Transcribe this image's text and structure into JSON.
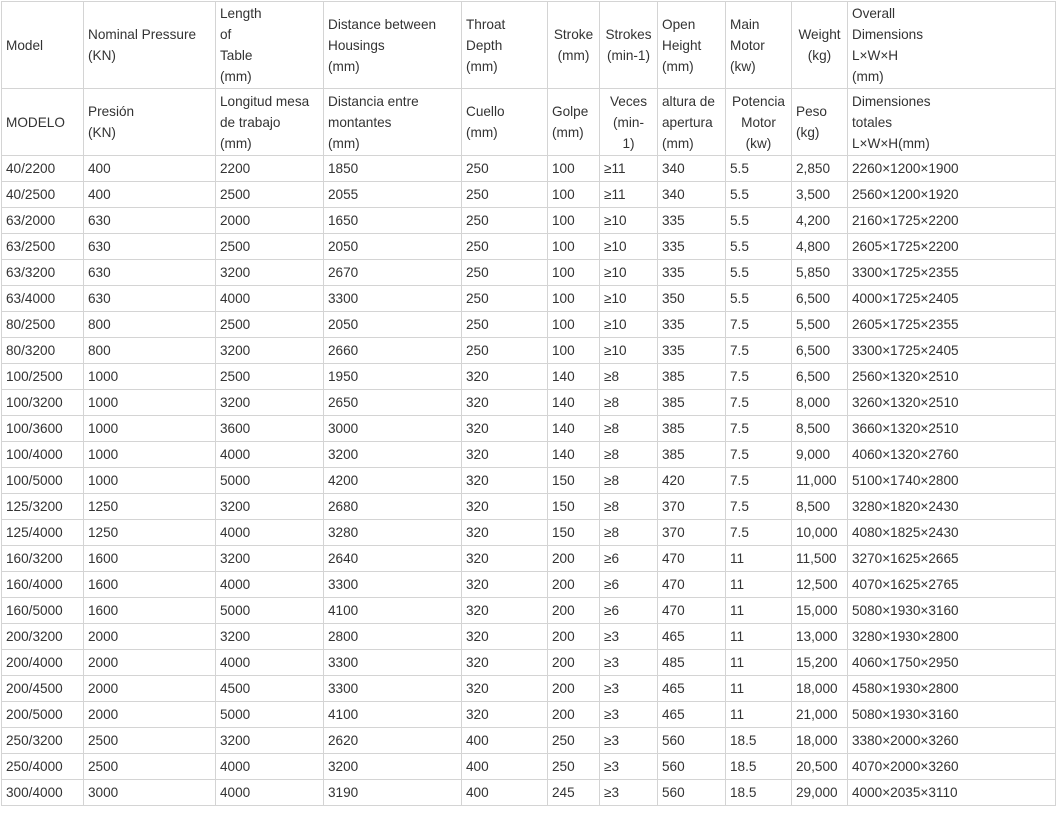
{
  "columns": [
    {
      "en": [
        "Model"
      ],
      "es": [
        "MODELO"
      ]
    },
    {
      "en": [
        "Nominal Pressure",
        "(KN)"
      ],
      "es": [
        "Presión",
        "(KN)"
      ]
    },
    {
      "en": [
        "Length",
        "of",
        "Table",
        "(mm)"
      ],
      "es": [
        "Longitud mesa",
        "de trabajo",
        "(mm)"
      ]
    },
    {
      "en": [
        "Distance between",
        "Housings",
        "(mm)"
      ],
      "es": [
        "Distancia entre",
        "montantes",
        "(mm)"
      ]
    },
    {
      "en": [
        "Throat",
        "Depth",
        "(mm)"
      ],
      "es": [
        "Cuello",
        "(mm)"
      ]
    },
    {
      "en": [
        "Stroke",
        "(mm)"
      ],
      "es": [
        "Golpe",
        "(mm)"
      ]
    },
    {
      "en": [
        "Strokes",
        "(min-1)"
      ],
      "es": [
        "Veces",
        "(min-",
        "1)"
      ]
    },
    {
      "en": [
        "Open",
        "Height",
        "(mm)"
      ],
      "es": [
        "altura de",
        "apertura",
        "(mm)"
      ]
    },
    {
      "en": [
        "Main",
        "Motor",
        "(kw)"
      ],
      "es": [
        "Potencia",
        "Motor",
        "(kw)"
      ]
    },
    {
      "en": [
        "Weight",
        "(kg)"
      ],
      "es": [
        "Peso",
        "(kg)"
      ]
    },
    {
      "en": [
        "Overall",
        "Dimensions",
        "L×W×H",
        "(mm)"
      ],
      "es": [
        "Dimensiones",
        "totales",
        "L×W×H(mm)"
      ]
    }
  ],
  "rows": [
    [
      "40/2200",
      "400",
      "2200",
      "1850",
      "250",
      "100",
      "≥11",
      "340",
      "5.5",
      "2,850",
      "2260×1200×1900"
    ],
    [
      "40/2500",
      "400",
      "2500",
      "2055",
      "250",
      "100",
      "≥11",
      "340",
      "5.5",
      "3,500",
      "2560×1200×1920"
    ],
    [
      "63/2000",
      "630",
      "2000",
      "1650",
      "250",
      "100",
      "≥10",
      "335",
      "5.5",
      "4,200",
      "2160×1725×2200"
    ],
    [
      "63/2500",
      "630",
      "2500",
      "2050",
      "250",
      "100",
      "≥10",
      "335",
      "5.5",
      "4,800",
      "2605×1725×2200"
    ],
    [
      "63/3200",
      "630",
      "3200",
      "2670",
      "250",
      "100",
      "≥10",
      "335",
      "5.5",
      "5,850",
      "3300×1725×2355"
    ],
    [
      "63/4000",
      "630",
      "4000",
      "3300",
      "250",
      "100",
      "≥10",
      "350",
      "5.5",
      "6,500",
      "4000×1725×2405"
    ],
    [
      "80/2500",
      "800",
      "2500",
      "2050",
      "250",
      "100",
      "≥10",
      "335",
      "7.5",
      "5,500",
      "2605×1725×2355"
    ],
    [
      "80/3200",
      "800",
      "3200",
      "2660",
      "250",
      "100",
      "≥10",
      "335",
      "7.5",
      "6,500",
      "3300×1725×2405"
    ],
    [
      "100/2500",
      "1000",
      "2500",
      "1950",
      "320",
      "140",
      "≥8",
      "385",
      "7.5",
      "6,500",
      "2560×1320×2510"
    ],
    [
      "100/3200",
      "1000",
      "3200",
      "2650",
      "320",
      "140",
      "≥8",
      "385",
      "7.5",
      "8,000",
      "3260×1320×2510"
    ],
    [
      "100/3600",
      "1000",
      "3600",
      "3000",
      "320",
      "140",
      "≥8",
      "385",
      "7.5",
      "8,500",
      "3660×1320×2510"
    ],
    [
      "100/4000",
      "1000",
      "4000",
      "3200",
      "320",
      "140",
      "≥8",
      "385",
      "7.5",
      "9,000",
      "4060×1320×2760"
    ],
    [
      "100/5000",
      "1000",
      "5000",
      "4200",
      "320",
      "150",
      "≥8",
      "420",
      "7.5",
      "11,000",
      "5100×1740×2800"
    ],
    [
      "125/3200",
      "1250",
      "3200",
      "2680",
      "320",
      "150",
      "≥8",
      "370",
      "7.5",
      "8,500",
      "3280×1820×2430"
    ],
    [
      "125/4000",
      "1250",
      "4000",
      "3280",
      "320",
      "150",
      "≥8",
      "370",
      "7.5",
      "10,000",
      "4080×1825×2430"
    ],
    [
      "160/3200",
      "1600",
      "3200",
      "2640",
      "320",
      "200",
      "≥6",
      "470",
      "11",
      "11,500",
      "3270×1625×2665"
    ],
    [
      "160/4000",
      "1600",
      "4000",
      "3300",
      "320",
      "200",
      "≥6",
      "470",
      "11",
      "12,500",
      "4070×1625×2765"
    ],
    [
      "160/5000",
      "1600",
      "5000",
      "4100",
      "320",
      "200",
      "≥6",
      "470",
      "11",
      "15,000",
      "5080×1930×3160"
    ],
    [
      "200/3200",
      "2000",
      "3200",
      "2800",
      "320",
      "200",
      "≥3",
      "465",
      "11",
      "13,000",
      "3280×1930×2800"
    ],
    [
      "200/4000",
      "2000",
      "4000",
      "3300",
      "320",
      "200",
      "≥3",
      "485",
      "11",
      "15,200",
      "4060×1750×2950"
    ],
    [
      "200/4500",
      "2000",
      "4500",
      "3300",
      "320",
      "200",
      "≥3",
      "465",
      "11",
      "18,000",
      "4580×1930×2800"
    ],
    [
      "200/5000",
      "2000",
      "5000",
      "4100",
      "320",
      "200",
      "≥3",
      "465",
      "11",
      "21,000",
      "5080×1930×3160"
    ],
    [
      "250/3200",
      "2500",
      "3200",
      "2620",
      "400",
      "250",
      "≥3",
      "560",
      "18.5",
      "18,000",
      "3380×2000×3260"
    ],
    [
      "250/4000",
      "2500",
      "4000",
      "3200",
      "400",
      "250",
      "≥3",
      "560",
      "18.5",
      "20,500",
      "4070×2000×3260"
    ],
    [
      "300/4000",
      "3000",
      "4000",
      "3190",
      "400",
      "245",
      "≥3",
      "560",
      "18.5",
      "29,000",
      "4000×2035×3110"
    ]
  ]
}
